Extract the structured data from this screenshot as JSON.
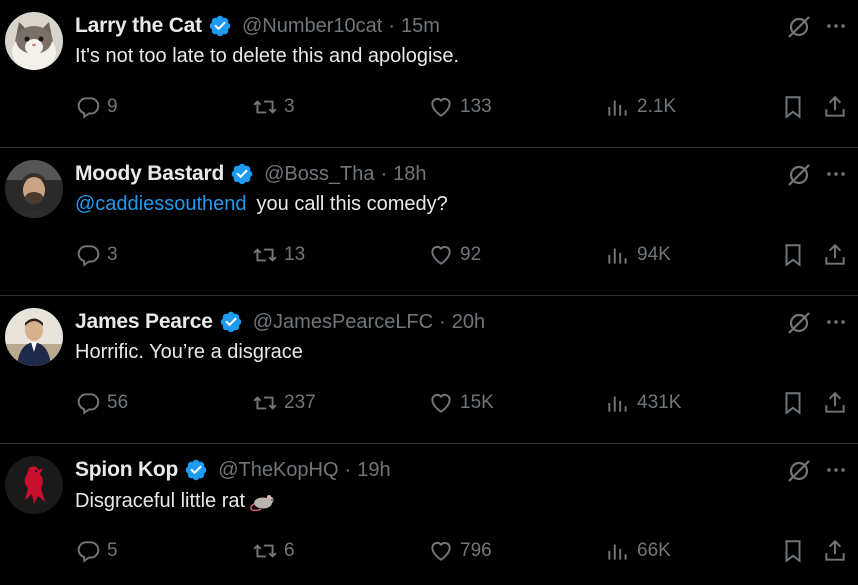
{
  "tweets": [
    {
      "name": "Larry the Cat",
      "handle": "@Number10cat",
      "separator": "·",
      "time": "15m",
      "mention": "",
      "text": "It's not too late to delete this and apologise.",
      "emoji": "",
      "replies": "9",
      "retweets": "3",
      "likes": "133",
      "views": "2.1K",
      "avatar_icon": "cat-avatar"
    },
    {
      "name": "Moody Bastard",
      "handle": "@Boss_Tha",
      "separator": "·",
      "time": "18h",
      "mention": "@caddiessouthend",
      "text": "you call this comedy?",
      "emoji": "",
      "replies": "3",
      "retweets": "13",
      "likes": "92",
      "views": "94K",
      "avatar_icon": "man-in-car-avatar"
    },
    {
      "name": "James Pearce",
      "handle": "@JamesPearceLFC",
      "separator": "·",
      "time": "20h",
      "mention": "",
      "text": "Horrific. You’re a disgrace",
      "emoji": "",
      "replies": "56",
      "retweets": "237",
      "likes": "15K",
      "views": "431K",
      "avatar_icon": "man-in-suit-avatar"
    },
    {
      "name": "Spion Kop",
      "handle": "@TheKopHQ",
      "separator": "·",
      "time": "19h",
      "mention": "",
      "text": "Disgraceful little rat",
      "emoji": "rat-emoji",
      "replies": "5",
      "retweets": "6",
      "likes": "796",
      "views": "66K",
      "avatar_icon": "liverbird-avatar"
    }
  ],
  "colors": {
    "background": "#000000",
    "text": "#e7e9ea",
    "muted": "#71767b",
    "accent": "#1d9bf0",
    "divider": "#2f3336"
  }
}
